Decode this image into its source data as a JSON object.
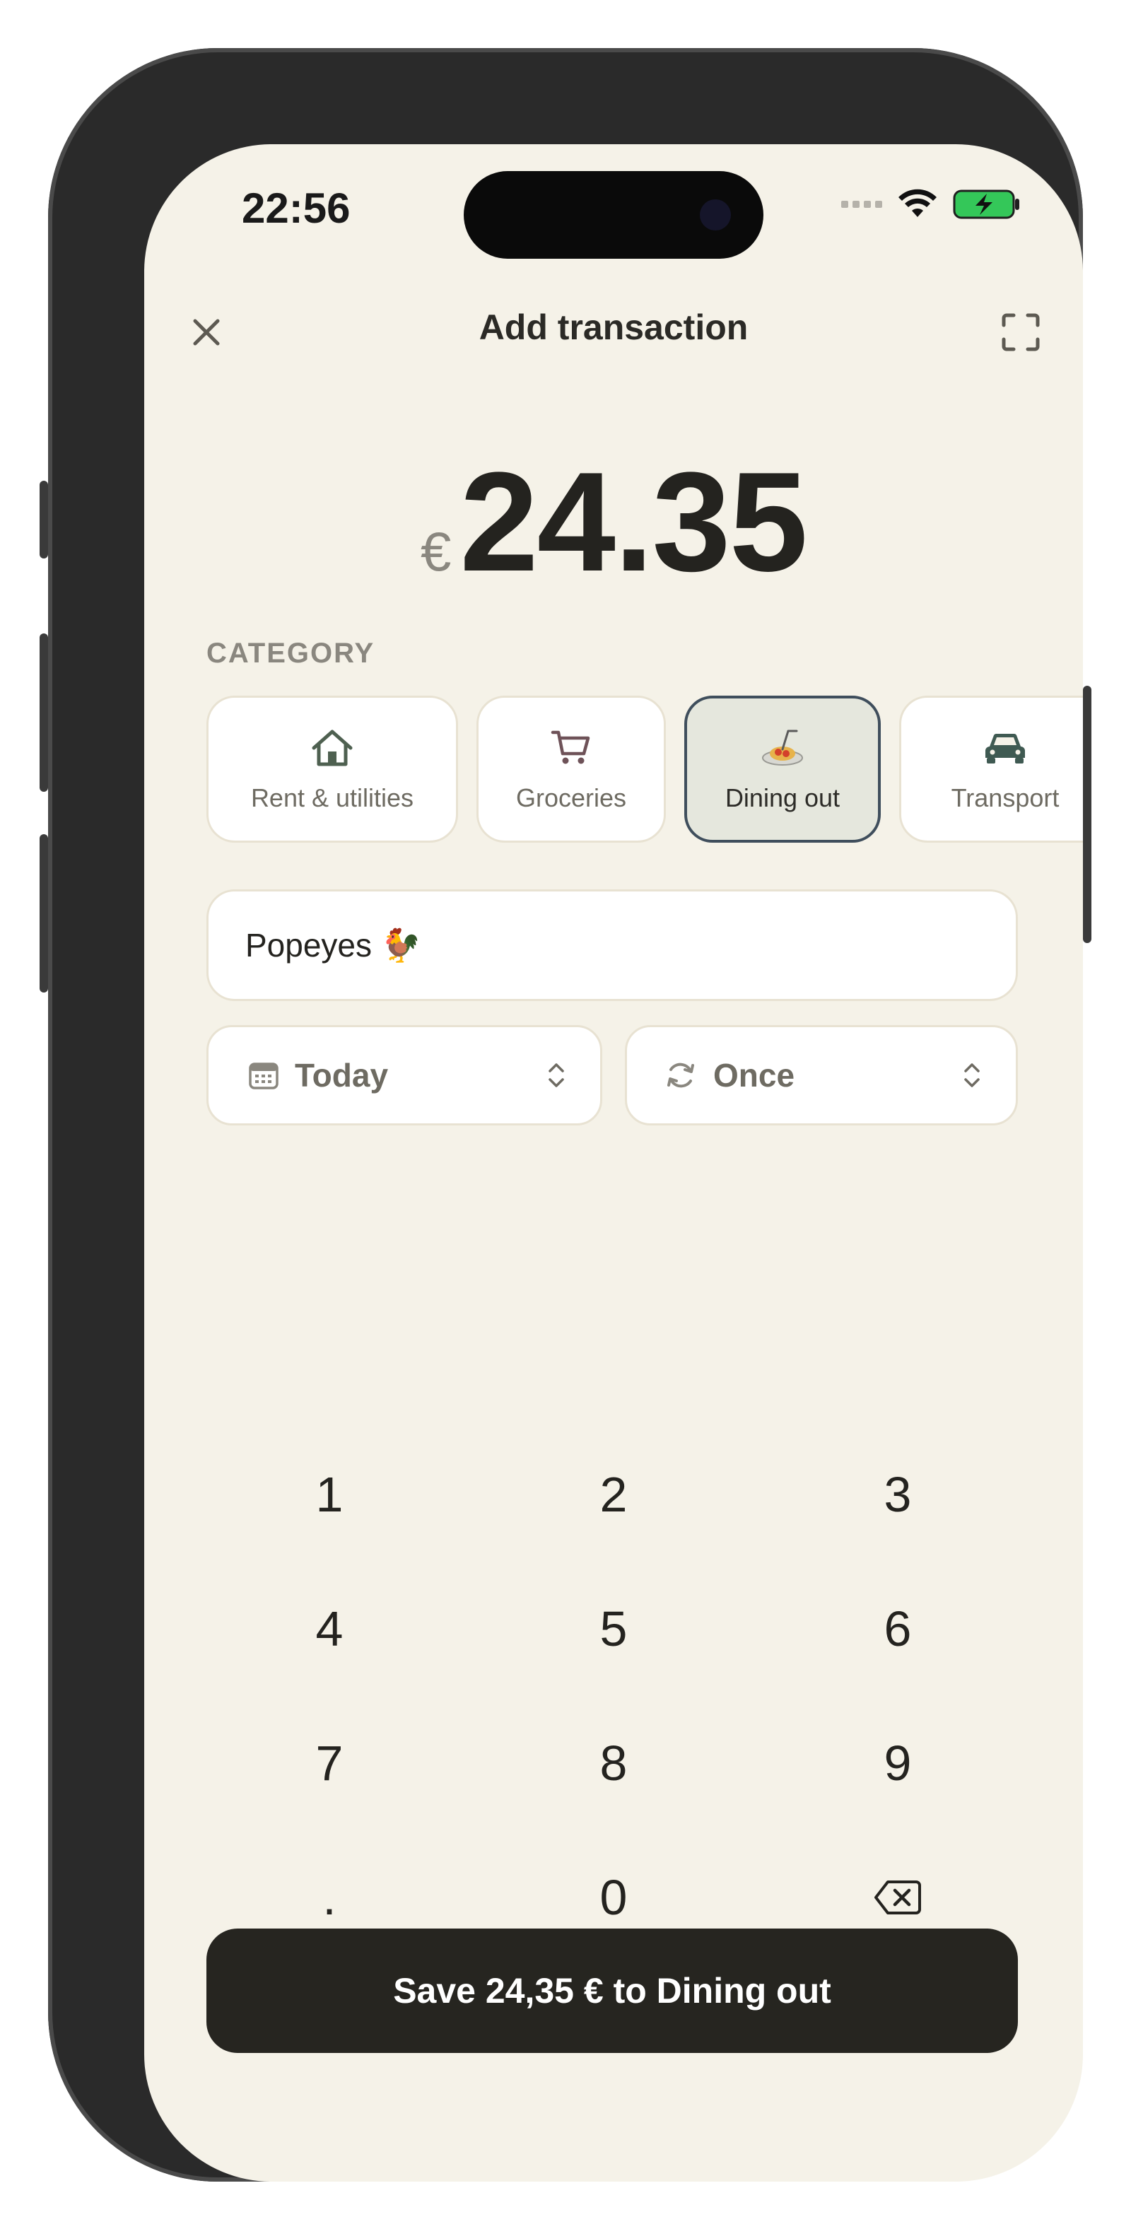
{
  "status_bar": {
    "time": "22:56"
  },
  "header": {
    "title": "Add transaction",
    "close_icon": "close-icon",
    "expand_icon": "expand-icon"
  },
  "amount": {
    "currency": "€",
    "value": "24.35"
  },
  "category": {
    "label": "CATEGORY",
    "items": [
      {
        "label": "Rent & utilities",
        "icon": "house-icon",
        "selected": false
      },
      {
        "label": "Groceries",
        "icon": "cart-icon",
        "selected": false
      },
      {
        "label": "Dining out",
        "icon": "spaghetti-icon",
        "selected": true
      },
      {
        "label": "Transport",
        "icon": "car-icon",
        "selected": false
      }
    ]
  },
  "name_field": {
    "value": "Popeyes 🐓"
  },
  "date_selector": {
    "label": "Today",
    "icon": "calendar-icon"
  },
  "repeat_selector": {
    "label": "Once",
    "icon": "repeat-icon"
  },
  "keypad": {
    "keys": [
      "1",
      "2",
      "3",
      "4",
      "5",
      "6",
      "7",
      "8",
      "9",
      ".",
      "0",
      "⌫"
    ]
  },
  "save_button": {
    "label": "Save 24,35 € to Dining out"
  },
  "colors": {
    "background": "#f5f2e8",
    "primary_button": "#262520",
    "selected_chip_border": "#3f4e5c",
    "battery_green": "#34c759"
  }
}
